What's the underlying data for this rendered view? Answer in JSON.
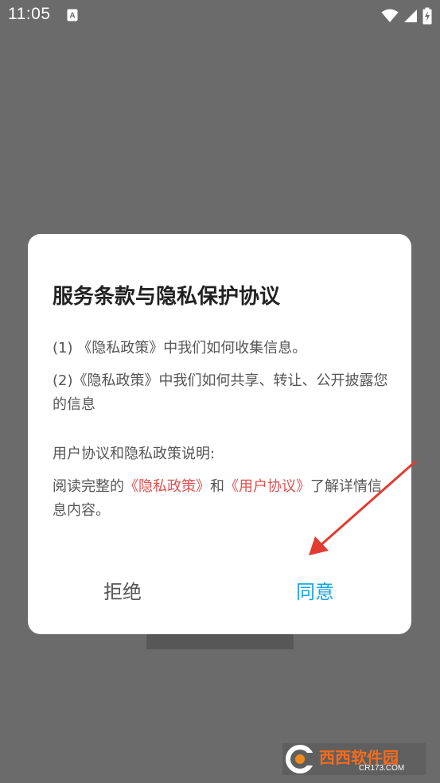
{
  "status_bar": {
    "time": "11:05",
    "icons": [
      "notification-a-icon",
      "wifi-icon",
      "signal-icon",
      "battery-charging-icon"
    ]
  },
  "dialog": {
    "title": "服务条款与隐私保护协议",
    "policy_1": {
      "prefix": "(1) ",
      "link": "《隐私政策》",
      "suffix": "中我们如何收集信息。"
    },
    "policy_2": {
      "prefix": "(2)",
      "link": "《隐私政策》",
      "suffix": "中我们如何共享、转让、公开披露您的信息"
    },
    "section_heading": "用户协议和隐私政策说明:",
    "section_body": {
      "prefix": "阅读完整的",
      "link_privacy": "《隐私政策》",
      "middle": "和",
      "link_user": "《用户协议》",
      "suffix": "了解详情信息内容。"
    },
    "reject_label": "拒绝",
    "agree_label": "同意"
  },
  "colors": {
    "overlay": "#6b6b6b",
    "link": "#e05050",
    "agree": "#1aa5e6",
    "arrow": "#e03c31"
  },
  "watermark": {
    "brand": "西西软件园",
    "domain": "CR173.COM"
  }
}
